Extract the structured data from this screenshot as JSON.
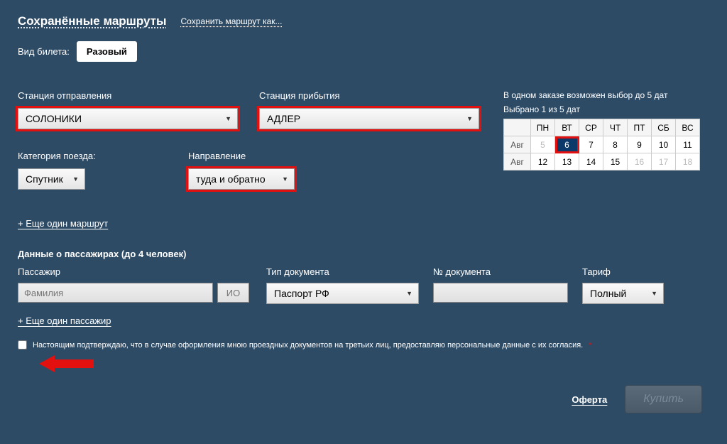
{
  "header": {
    "saved_routes": "Сохранённые маршруты",
    "save_as": "Сохранить маршрут как..."
  },
  "ticket": {
    "type_label": "Вид билета:",
    "type_value": "Разовый"
  },
  "stations": {
    "from_label": "Станция отправления",
    "from_value": "СОЛОНИКИ",
    "to_label": "Станция прибытия",
    "to_value": "АДЛЕР"
  },
  "category": {
    "label": "Категория поезда:",
    "value": "Спутник"
  },
  "direction": {
    "label": "Направление",
    "value": "туда и обратно"
  },
  "add_route": "+ Еще один маршрут",
  "pax": {
    "title": "Данные о пассажирах (до 4 человек)",
    "col_name": "Пассажир",
    "col_doc": "Тип документа",
    "col_num": "№ документа",
    "col_tarif": "Тариф",
    "surname_placeholder": "Фамилия",
    "io_placeholder": "ИО",
    "doc_value": "Паспорт РФ",
    "tarif_value": "Полный"
  },
  "add_pax": "+ Еще один пассажир",
  "consent": "Настоящим подтверждаю, что в случае оформления мною проездных документов на третьих лиц, предоставляю персональные данные с их согласия.",
  "calendar": {
    "info1": "В одном заказе возможен выбор до 5 дат",
    "info2": "Выбрано 1 из 5 дат",
    "days": [
      "ПН",
      "ВТ",
      "СР",
      "ЧТ",
      "ПТ",
      "СБ",
      "ВС"
    ],
    "month": "Авг",
    "row1": [
      "5",
      "6",
      "7",
      "8",
      "9",
      "10",
      "11"
    ],
    "row2": [
      "12",
      "13",
      "14",
      "15",
      "16",
      "17",
      "18"
    ]
  },
  "footer": {
    "offer": "Оферта",
    "buy": "Купить"
  }
}
